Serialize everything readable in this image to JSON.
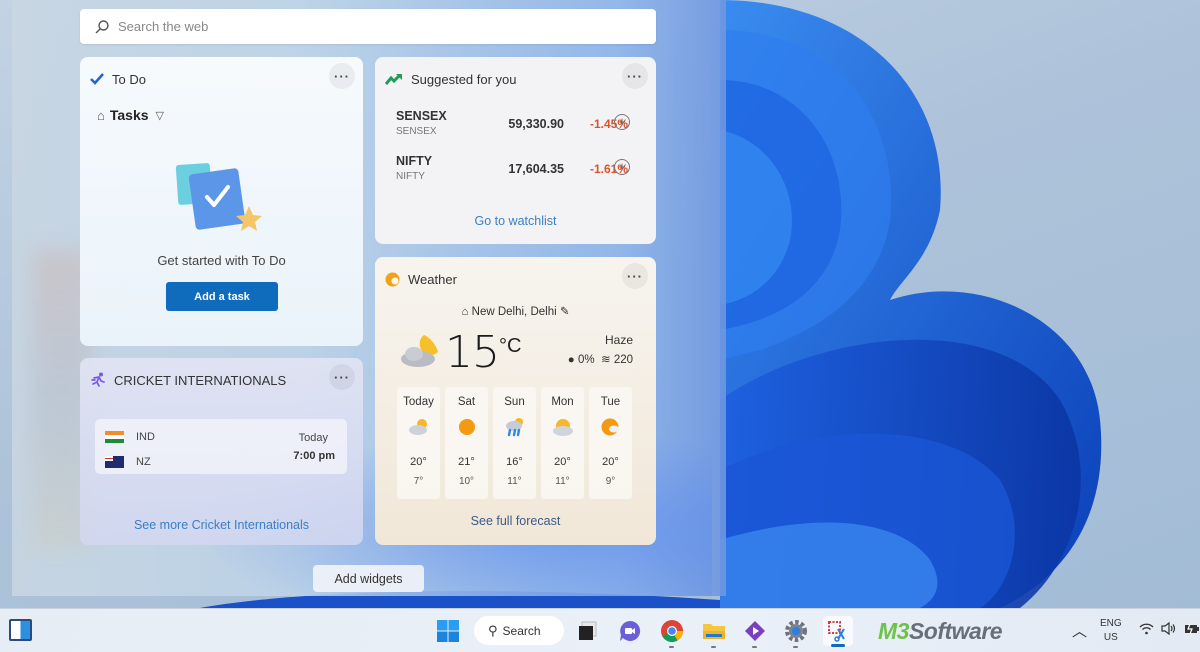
{
  "search": {
    "placeholder": "Search the web"
  },
  "todo": {
    "title": "To Do",
    "more_label": "···",
    "list_name": "Tasks",
    "message": "Get started with To Do",
    "add_button": "Add a task"
  },
  "stocks": {
    "title": "Suggested for you",
    "more_label": "···",
    "items": [
      {
        "symbol": "SENSEX",
        "name": "SENSEX",
        "price": "59,330.90",
        "change": "-1.45%",
        "change_color": "#d9532c"
      },
      {
        "symbol": "NIFTY",
        "name": "NIFTY",
        "price": "17,604.35",
        "change": "-1.61%",
        "change_color": "#d9532c"
      }
    ],
    "add_symbol": "+",
    "link": "Go to watchlist"
  },
  "cricket": {
    "title": "CRICKET INTERNATIONALS",
    "more_label": "···",
    "match": {
      "team1": "IND",
      "team2": "NZ",
      "day": "Today",
      "time": "7:00 pm"
    },
    "link": "See more Cricket Internationals"
  },
  "weather": {
    "title": "Weather",
    "more_label": "···",
    "location": "New Delhi, Delhi",
    "temperature": "15",
    "unit": "°C",
    "condition": "Haze",
    "precipitation": "0%",
    "aqi": "220",
    "forecast": [
      {
        "day": "Today",
        "icon": "partly-cloudy-icon",
        "high": "20°",
        "low": "7°"
      },
      {
        "day": "Sat",
        "icon": "sunny-icon",
        "high": "21°",
        "low": "10°"
      },
      {
        "day": "Sun",
        "icon": "rain-showers-icon",
        "high": "16°",
        "low": "11°"
      },
      {
        "day": "Mon",
        "icon": "partly-cloudy-icon",
        "high": "20°",
        "low": "11°"
      },
      {
        "day": "Tue",
        "icon": "mostly-sunny-icon",
        "high": "20°",
        "low": "9°"
      }
    ],
    "link": "See full forecast"
  },
  "add_widgets": "Add widgets",
  "taskbar": {
    "search_label": "Search",
    "apps": [
      "Start",
      "Search",
      "Task View",
      "Teams Chat",
      "Chrome",
      "File Explorer",
      "Visual Studio",
      "Settings",
      "Snipping Tool"
    ],
    "watermark_m3": "M3",
    "watermark_software": "Software",
    "language_line1": "ENG",
    "language_line2": "US",
    "accent": "#0f6cbd"
  }
}
